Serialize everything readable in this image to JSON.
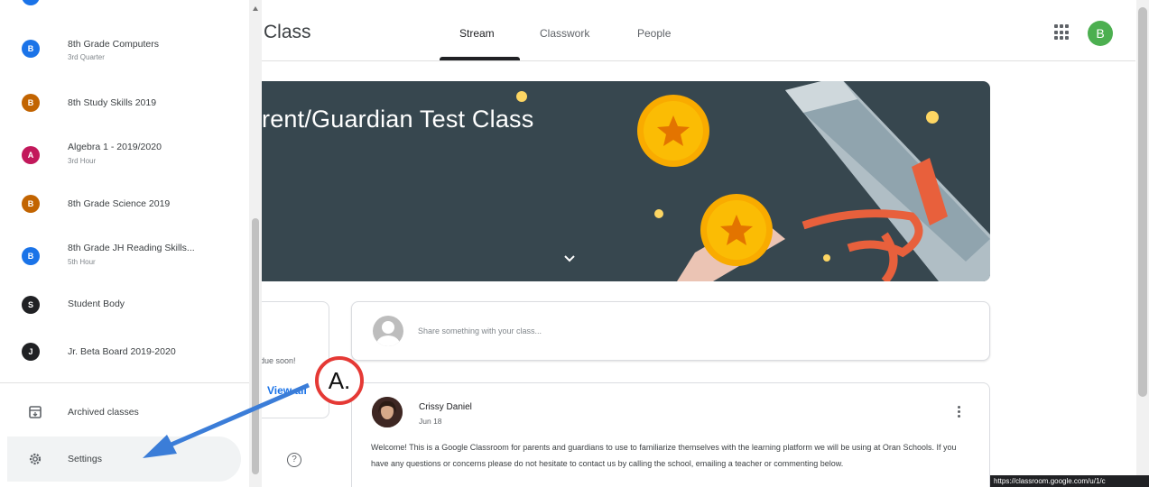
{
  "header": {
    "class_title": "Class",
    "tabs": [
      {
        "label": "Stream",
        "active": true
      },
      {
        "label": "Classwork",
        "active": false
      },
      {
        "label": "People",
        "active": false
      }
    ],
    "account_initial": "B",
    "account_color": "#4caf50"
  },
  "banner": {
    "title": "rent/Guardian Test Class",
    "bg_color": "#37474f"
  },
  "upcoming": {
    "due_text": "due soon!",
    "view_all_label": "View all"
  },
  "share": {
    "placeholder": "Share something with your class..."
  },
  "post": {
    "author": "Crissy Daniel",
    "date": "Jun 18",
    "body": "Welcome! This is a Google Classroom for parents and guardians to use to familiarize themselves with the learning platform we will be using at Oran Schools. If you have any questions or concerns please do not hesitate to contact us by calling the school, emailing a teacher or commenting below."
  },
  "drawer": {
    "classes": [
      {
        "initial": "B",
        "name": "8th Grade Computers",
        "sub": "3rd Quarter",
        "color": "#1a73e8"
      },
      {
        "initial": "B",
        "name": "8th Study Skills 2019",
        "sub": "",
        "color": "#c26401"
      },
      {
        "initial": "A",
        "name": "Algebra 1 - 2019/2020",
        "sub": "3rd Hour",
        "color": "#c2185b"
      },
      {
        "initial": "B",
        "name": "8th Grade Science 2019",
        "sub": "",
        "color": "#c26401"
      },
      {
        "initial": "B",
        "name": "8th Grade JH Reading Skills...",
        "sub": "5th Hour",
        "color": "#1a73e8"
      },
      {
        "initial": "S",
        "name": "Student Body",
        "sub": "",
        "color": "#202124"
      },
      {
        "initial": "J",
        "name": "Jr. Beta Board 2019-2020",
        "sub": "",
        "color": "#202124"
      }
    ],
    "archived_label": "Archived classes",
    "settings_label": "Settings"
  },
  "annotation": {
    "label": "A.",
    "circle_color": "#e53935",
    "arrow_color": "#3b7dd8"
  },
  "status_url": "https://classroom.google.com/u/1/c"
}
